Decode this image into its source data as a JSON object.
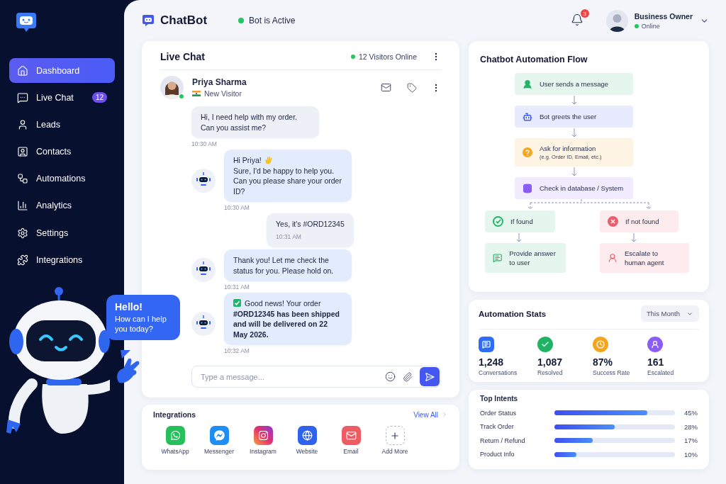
{
  "sidebar": {
    "items": [
      {
        "label": "Dashboard",
        "selected": true
      },
      {
        "label": "Live Chat",
        "selected": false,
        "badge": "12"
      },
      {
        "label": "Leads",
        "selected": false
      },
      {
        "label": "Contacts",
        "selected": false
      },
      {
        "label": "Automations",
        "selected": false
      },
      {
        "label": "Analytics",
        "selected": false
      },
      {
        "label": "Settings",
        "selected": false
      },
      {
        "label": "Integrations",
        "selected": false
      }
    ],
    "mascot": {
      "heading": "Hello!",
      "text": "How can I help you today?"
    }
  },
  "header": {
    "brand": "ChatBot",
    "status": "Bot is Active",
    "notifications": "3",
    "user": {
      "name": "Business Owner",
      "status": "Online"
    }
  },
  "live_chat": {
    "title": "Live Chat",
    "visitors": "12 Visitors Online",
    "contact": {
      "name": "Priya Sharma",
      "label": "New Visitor"
    },
    "messages": [
      {
        "kind": "visitor",
        "text": "Hi, I need help with my order. Can you assist me?",
        "time": "10:30 AM",
        "time_inside": false
      },
      {
        "kind": "bot-greeting",
        "heading": "Hi Priya!",
        "text": "Sure, I'd be happy to help you. Can you please share your order ID?",
        "time": "10:30 AM"
      },
      {
        "kind": "visitor",
        "text": "Yes, it's #ORD12345",
        "time": "10:31 AM",
        "time_inside": true
      },
      {
        "kind": "bot",
        "text": "Thank you! Let me check the status for you. Please hold on.",
        "time": "10:31 AM"
      },
      {
        "kind": "bot-success",
        "text": "Good news! Your order **#ORD12345 has been shipped and will be delivered on 22 May 2026.**",
        "time": "10:32 AM"
      }
    ],
    "input": {
      "placeholder": "Type a message..."
    }
  },
  "integrations": {
    "title": "Integrations",
    "link": "View All",
    "items": [
      {
        "label": "WhatsApp",
        "kind": "app"
      },
      {
        "label": "Messenger",
        "kind": "app"
      },
      {
        "label": "Instagram",
        "kind": "app"
      },
      {
        "label": "Website",
        "kind": "app"
      },
      {
        "label": "Email",
        "kind": "app"
      },
      {
        "label": "Add More",
        "kind": "add"
      }
    ]
  },
  "flow": {
    "title": "Chatbot Automation Flow",
    "steps": [
      {
        "text": "User sends a message",
        "color": "#22b46a"
      },
      {
        "text": "Bot greets the user",
        "color": "#3f5bf0"
      },
      {
        "text": "Ask for information",
        "subtext": "(e.g. Order ID, Email, etc.)",
        "color": "#f6a623"
      },
      {
        "text": "Check in database / System",
        "color": "#8b5cf6"
      }
    ],
    "branches": [
      {
        "condition": "If found",
        "action": "Provide answer to user",
        "color": "#22b46a"
      },
      {
        "condition": "If not found",
        "action": "Escalate to human agent",
        "color": "#ef5b6b"
      }
    ]
  },
  "stats": {
    "title": "Automation Stats",
    "period": "This Month",
    "items": [
      {
        "value": "1,248",
        "label": "Conversations",
        "color": "#2f6bf5"
      },
      {
        "value": "1,087",
        "label": "Resolved",
        "color": "#1fb464"
      },
      {
        "value": "87%",
        "label": "Success Rate",
        "color": "#f7a41d"
      },
      {
        "value": "161",
        "label": "Escalated",
        "color": "#8b5cf6"
      }
    ]
  },
  "intents": {
    "title": "Top Intents",
    "items": [
      {
        "label": "Order Status",
        "level": 0.77,
        "percent": "45%"
      },
      {
        "label": "Track Order",
        "level": 0.5,
        "percent": "28%"
      },
      {
        "label": "Return / Refund",
        "level": 0.32,
        "percent": "17%"
      },
      {
        "label": "Product Info",
        "level": 0.18,
        "percent": "10%"
      }
    ]
  }
}
